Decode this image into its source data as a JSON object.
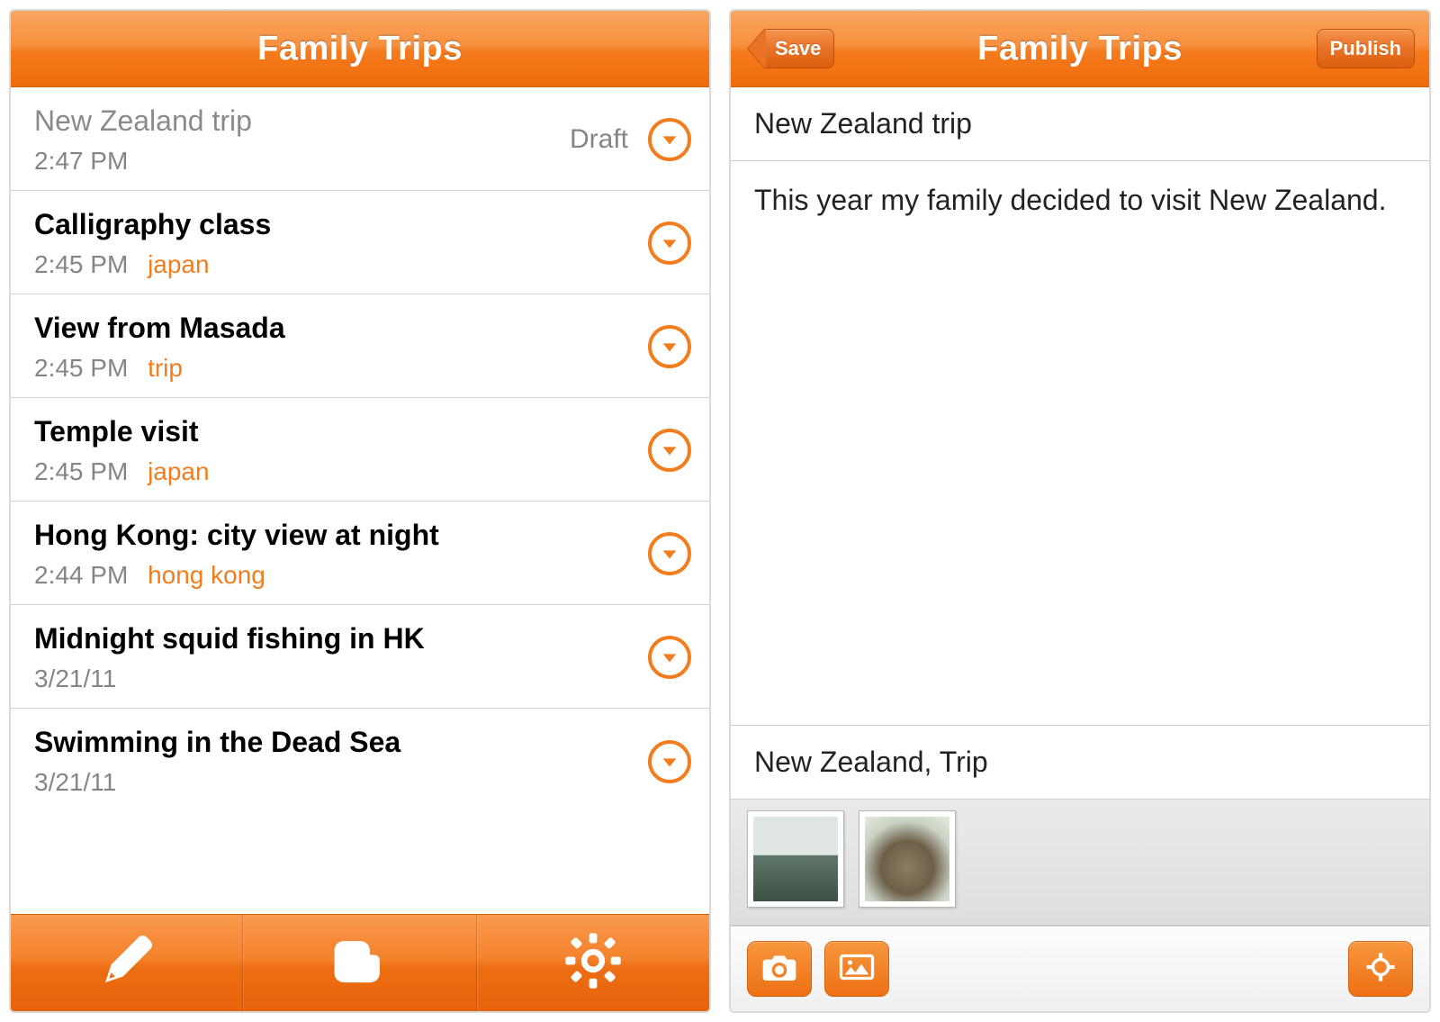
{
  "left": {
    "title": "Family Trips",
    "posts": [
      {
        "title": "New Zealand trip",
        "time": "2:47 PM",
        "tag": "",
        "status": "Draft",
        "draft": true
      },
      {
        "title": "Calligraphy class",
        "time": "2:45 PM",
        "tag": "japan",
        "status": "",
        "draft": false
      },
      {
        "title": "View from Masada",
        "time": "2:45 PM",
        "tag": "trip",
        "status": "",
        "draft": false
      },
      {
        "title": "Temple visit",
        "time": "2:45 PM",
        "tag": "japan",
        "status": "",
        "draft": false
      },
      {
        "title": "Hong Kong: city view at night",
        "time": "2:44 PM",
        "tag": "hong kong",
        "status": "",
        "draft": false
      },
      {
        "title": "Midnight squid fishing in HK",
        "time": "3/21/11",
        "tag": "",
        "status": "",
        "draft": false
      },
      {
        "title": "Swimming in the Dead Sea",
        "time": "3/21/11",
        "tag": "",
        "status": "",
        "draft": false
      }
    ],
    "nav": {
      "compose": "compose",
      "blogger": "blogger",
      "settings": "settings"
    }
  },
  "right": {
    "save_label": "Save",
    "title": "Family Trips",
    "publish_label": "Publish",
    "post_title": "New Zealand trip",
    "post_body": "This year my family decided to visit New Zealand.",
    "post_tags": "New Zealand, Trip",
    "toolbar": {
      "camera": "camera",
      "gallery": "gallery",
      "location": "location"
    }
  }
}
